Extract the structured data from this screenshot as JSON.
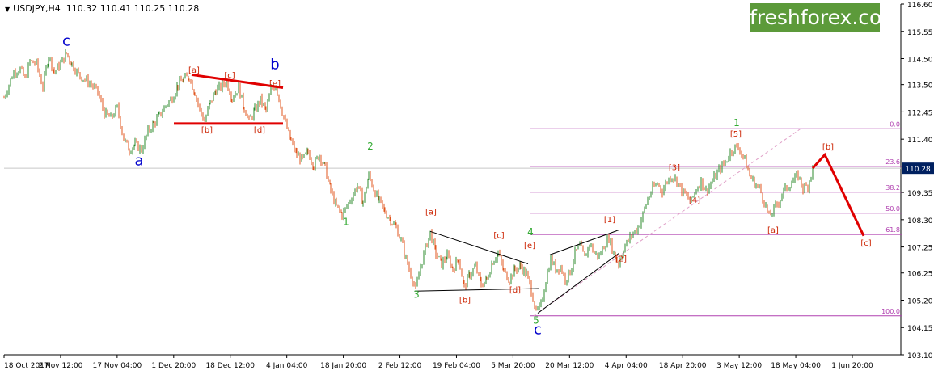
{
  "header": {
    "symbol": "USDJPY,H4",
    "ohlc": "110.32 110.41 110.25 110.28"
  },
  "brand": {
    "name": "freshforex.com"
  },
  "colors": {
    "up_candle": "#2e8b2e",
    "down_candle": "#e0541c",
    "fib": "#b040b0",
    "bear_path": "#e00000",
    "wave_blue": "#0000cc",
    "wave_green": "#33aa33",
    "wave_red": "#cc2200",
    "price_tag": "#002060"
  },
  "chart_data": {
    "type": "candlestick",
    "title": "",
    "xlabel": "",
    "ylabel": "",
    "ylim": [
      103.1,
      116.6
    ],
    "y_ticks": [
      116.6,
      115.55,
      114.5,
      113.5,
      112.45,
      111.4,
      110.35,
      109.35,
      108.3,
      107.25,
      106.25,
      105.2,
      104.15,
      103.1
    ],
    "x_ticks": [
      "18 Oct 2017",
      "2 Nov 12:00",
      "17 Nov 04:00",
      "1 Dec 20:00",
      "18 Dec 12:00",
      "4 Jan 04:00",
      "18 Jan 20:00",
      "2 Feb 12:00",
      "19 Feb 04:00",
      "5 Mar 20:00",
      "20 Mar 12:00",
      "4 Apr 04:00",
      "18 Apr 20:00",
      "3 May 12:00",
      "18 May 04:00",
      "1 Jun 20:00"
    ],
    "current_price": 110.28,
    "price_path": [
      [
        0,
        113.0
      ],
      [
        6,
        113.5
      ],
      [
        12,
        114.0
      ],
      [
        20,
        114.1
      ],
      [
        26,
        113.7
      ],
      [
        32,
        114.4
      ],
      [
        40,
        114.3
      ],
      [
        48,
        113.4
      ],
      [
        55,
        114.6
      ],
      [
        62,
        114.0
      ],
      [
        70,
        114.3
      ],
      [
        77,
        114.7
      ],
      [
        84,
        114.3
      ],
      [
        92,
        113.9
      ],
      [
        100,
        113.7
      ],
      [
        108,
        113.5
      ],
      [
        116,
        113.2
      ],
      [
        124,
        112.4
      ],
      [
        132,
        112.2
      ],
      [
        140,
        112.6
      ],
      [
        148,
        111.4
      ],
      [
        155,
        111.0
      ],
      [
        162,
        111.2
      ],
      [
        170,
        111.0
      ],
      [
        178,
        111.7
      ],
      [
        185,
        112.0
      ],
      [
        192,
        112.3
      ],
      [
        200,
        112.7
      ],
      [
        208,
        113.0
      ],
      [
        215,
        113.5
      ],
      [
        222,
        113.7
      ],
      [
        229,
        113.8
      ],
      [
        236,
        113.2
      ],
      [
        242,
        112.5
      ],
      [
        248,
        112.1
      ],
      [
        255,
        112.8
      ],
      [
        262,
        113.3
      ],
      [
        268,
        113.4
      ],
      [
        275,
        113.6
      ],
      [
        282,
        113.0
      ],
      [
        290,
        113.4
      ],
      [
        297,
        112.6
      ],
      [
        303,
        112.1
      ],
      [
        310,
        112.5
      ],
      [
        317,
        112.9
      ],
      [
        324,
        112.5
      ],
      [
        330,
        113.3
      ],
      [
        336,
        113.5
      ],
      [
        342,
        112.7
      ],
      [
        348,
        112.0
      ],
      [
        355,
        111.3
      ],
      [
        362,
        110.8
      ],
      [
        369,
        110.6
      ],
      [
        376,
        110.9
      ],
      [
        383,
        110.4
      ],
      [
        390,
        110.8
      ],
      [
        397,
        110.3
      ],
      [
        404,
        109.4
      ],
      [
        411,
        108.8
      ],
      [
        418,
        108.5
      ],
      [
        424,
        108.8
      ],
      [
        430,
        109.2
      ],
      [
        437,
        109.6
      ],
      [
        444,
        109.0
      ],
      [
        451,
        110.0
      ],
      [
        457,
        109.5
      ],
      [
        464,
        109.0
      ],
      [
        471,
        108.6
      ],
      [
        478,
        108.3
      ],
      [
        485,
        108.0
      ],
      [
        491,
        107.5
      ],
      [
        497,
        106.8
      ],
      [
        503,
        106.2
      ],
      [
        509,
        105.6
      ],
      [
        515,
        106.5
      ],
      [
        521,
        107.2
      ],
      [
        527,
        107.8
      ],
      [
        534,
        107.0
      ],
      [
        541,
        106.6
      ],
      [
        548,
        106.9
      ],
      [
        555,
        106.4
      ],
      [
        562,
        106.8
      ],
      [
        569,
        105.7
      ],
      [
        576,
        106.2
      ],
      [
        583,
        106.5
      ],
      [
        590,
        105.8
      ],
      [
        597,
        106.0
      ],
      [
        604,
        106.7
      ],
      [
        611,
        107.0
      ],
      [
        618,
        106.3
      ],
      [
        625,
        106.0
      ],
      [
        632,
        106.4
      ],
      [
        639,
        106.5
      ],
      [
        646,
        106.2
      ],
      [
        652,
        105.6
      ],
      [
        658,
        104.7
      ],
      [
        664,
        105.0
      ],
      [
        670,
        106.0
      ],
      [
        676,
        106.8
      ],
      [
        682,
        106.4
      ],
      [
        688,
        106.5
      ],
      [
        694,
        106.0
      ],
      [
        700,
        106.3
      ],
      [
        706,
        107.0
      ],
      [
        712,
        107.3
      ],
      [
        718,
        106.8
      ],
      [
        724,
        107.4
      ],
      [
        730,
        107.0
      ],
      [
        736,
        106.9
      ],
      [
        742,
        107.3
      ],
      [
        748,
        107.6
      ],
      [
        754,
        107.0
      ],
      [
        760,
        106.6
      ],
      [
        766,
        107.2
      ],
      [
        772,
        107.5
      ],
      [
        778,
        107.8
      ],
      [
        784,
        108.0
      ],
      [
        790,
        108.5
      ],
      [
        796,
        109.1
      ],
      [
        802,
        109.5
      ],
      [
        808,
        109.7
      ],
      [
        814,
        109.4
      ],
      [
        820,
        109.8
      ],
      [
        826,
        110.0
      ],
      [
        832,
        109.8
      ],
      [
        838,
        109.4
      ],
      [
        844,
        109.2
      ],
      [
        850,
        109.0
      ],
      [
        856,
        109.5
      ],
      [
        862,
        109.8
      ],
      [
        868,
        109.4
      ],
      [
        874,
        109.7
      ],
      [
        880,
        110.0
      ],
      [
        886,
        110.3
      ],
      [
        892,
        110.5
      ],
      [
        898,
        110.9
      ],
      [
        904,
        111.1
      ],
      [
        910,
        111.0
      ],
      [
        916,
        110.6
      ],
      [
        922,
        110.0
      ],
      [
        928,
        109.7
      ],
      [
        934,
        109.5
      ],
      [
        940,
        109.0
      ],
      [
        946,
        108.4
      ],
      [
        952,
        108.7
      ],
      [
        958,
        109.0
      ],
      [
        964,
        109.4
      ],
      [
        970,
        109.6
      ],
      [
        976,
        109.8
      ],
      [
        982,
        110.0
      ],
      [
        988,
        109.5
      ],
      [
        994,
        109.6
      ],
      [
        1000,
        110.28
      ]
    ]
  },
  "fibonacci": {
    "levels": [
      {
        "label": "0.0",
        "price": 111.8
      },
      {
        "label": "23.6",
        "price": 110.35
      },
      {
        "label": "38.2",
        "price": 109.36
      },
      {
        "label": "50.0",
        "price": 108.55
      },
      {
        "label": "61.8",
        "price": 107.73
      },
      {
        "label": "100.0",
        "price": 104.6
      }
    ]
  },
  "bear_projection": [
    {
      "price": 110.28
    },
    {
      "price": 110.8
    },
    {
      "price": 107.68
    }
  ],
  "wave_labels": {
    "blue": [
      {
        "text": "c",
        "price": 115.0
      },
      {
        "text": "a",
        "price": 110.4
      },
      {
        "text": "b",
        "price": 114.1
      },
      {
        "text": "c",
        "price": 103.9
      }
    ],
    "green": [
      {
        "text": "2",
        "price": 111.0
      },
      {
        "text": "1",
        "price": 108.1
      },
      {
        "text": "3",
        "price": 105.3
      },
      {
        "text": "4",
        "price": 107.7
      },
      {
        "text": "5",
        "price": 104.3
      },
      {
        "text": "1",
        "price": 111.9
      }
    ],
    "red": [
      {
        "text": "[a]",
        "price": 113.95
      },
      {
        "text": "[c]",
        "price": 113.75
      },
      {
        "text": "[e]",
        "price": 113.45
      },
      {
        "text": "[b]",
        "price": 111.65
      },
      {
        "text": "[d]",
        "price": 111.65
      },
      {
        "text": "[a]",
        "price": 108.5
      },
      {
        "text": "[c]",
        "price": 107.6
      },
      {
        "text": "[e]",
        "price": 107.2
      },
      {
        "text": "[b]",
        "price": 105.1
      },
      {
        "text": "[d]",
        "price": 105.5
      },
      {
        "text": "[1]",
        "price": 108.2
      },
      {
        "text": "[2]",
        "price": 106.7
      },
      {
        "text": "[3]",
        "price": 110.2
      },
      {
        "text": "[4]",
        "price": 108.95
      },
      {
        "text": "[5]",
        "price": 111.5
      },
      {
        "text": "[a]",
        "price": 107.8
      },
      {
        "text": "[b]",
        "price": 111.0
      },
      {
        "text": "[c]",
        "price": 107.3
      }
    ]
  }
}
